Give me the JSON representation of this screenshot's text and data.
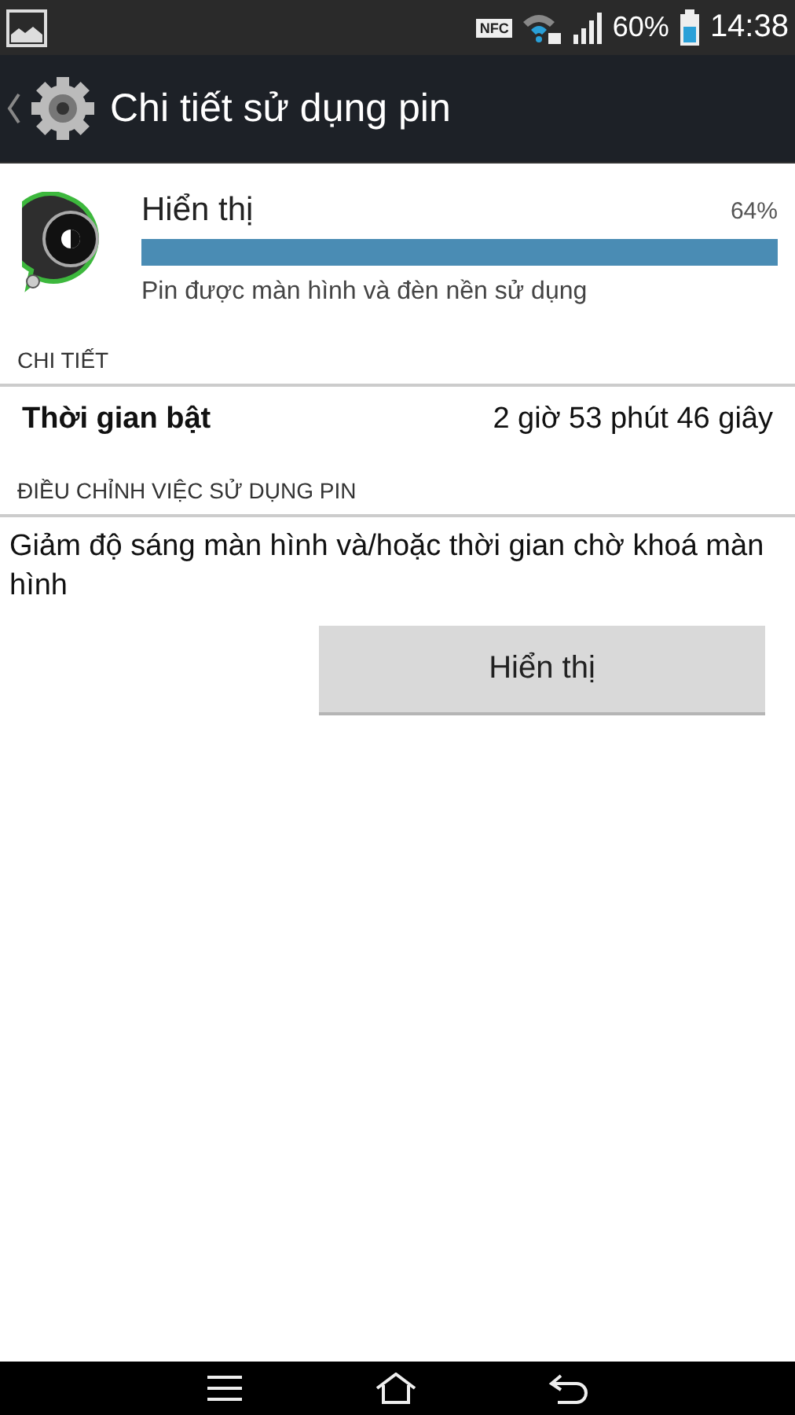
{
  "status_bar": {
    "battery_text": "60%",
    "time": "14:38",
    "nfc": "NFC"
  },
  "action_bar": {
    "title": "Chi tiết sử dụng pin"
  },
  "usage": {
    "name": "Hiển thị",
    "percent": "64%",
    "level": 1,
    "description": "Pin được màn hình và đèn nền sử dụng"
  },
  "details": {
    "header": "CHI TIẾT",
    "rows": [
      {
        "label": "Thời gian bật",
        "value": "2 giờ 53 phút 46 giây"
      }
    ]
  },
  "adjust": {
    "header": "ĐIỀU CHỈNH VIỆC SỬ DỤNG PIN",
    "text": "Giảm độ sáng màn hình và/hoặc thời gian chờ khoá màn hình",
    "button": "Hiển thị"
  }
}
